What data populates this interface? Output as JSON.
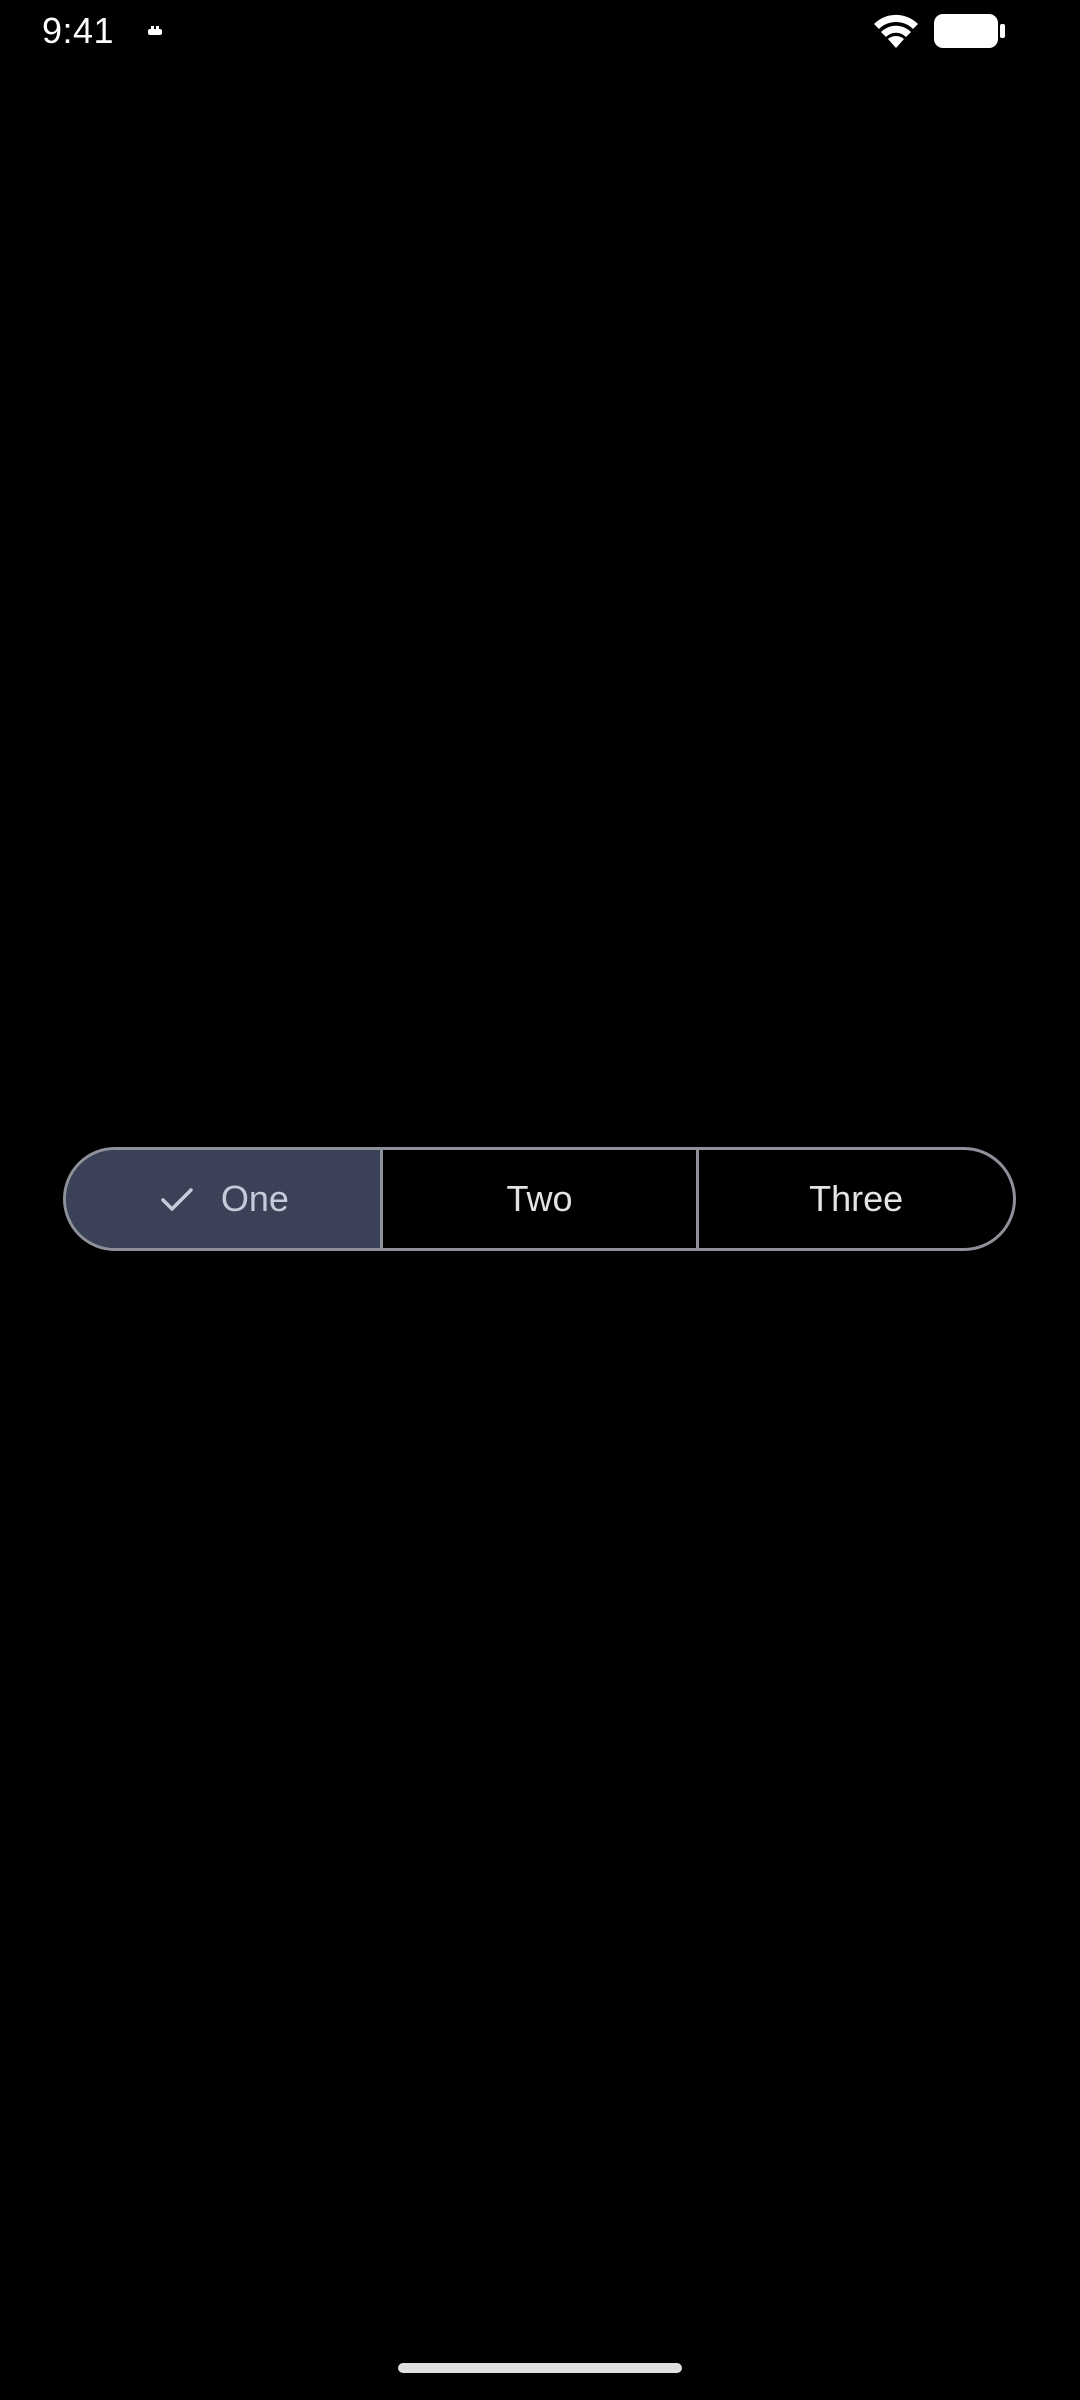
{
  "status_bar": {
    "time": "9:41",
    "icons": [
      "notification-icon",
      "wifi-icon",
      "battery-icon"
    ]
  },
  "segmented_button": {
    "segments": [
      {
        "label": "One",
        "selected": true,
        "icon": "check-icon"
      },
      {
        "label": "Two",
        "selected": false
      },
      {
        "label": "Three",
        "selected": false
      }
    ]
  },
  "colors": {
    "background": "#000000",
    "outline": "#8e9199",
    "selected_container": "#3b4258",
    "selected_text": "#c7cad8",
    "text": "#e3e3e6"
  }
}
